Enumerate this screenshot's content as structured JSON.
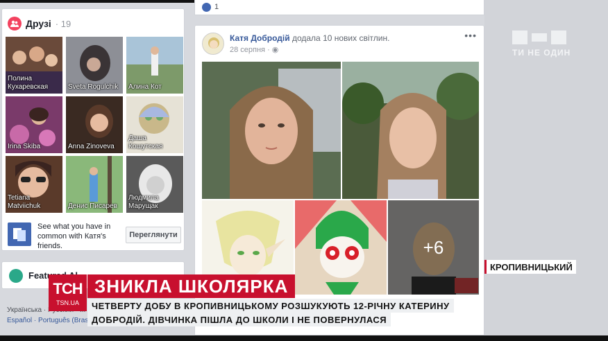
{
  "friends": {
    "title": "Друзі",
    "count": "· 19",
    "tiles": [
      {
        "name": "Полина Кухаревская",
        "color": "#6a4a3a"
      },
      {
        "name": "Sveta Rogulchik",
        "color": "#8d8f96"
      },
      {
        "name": "Алина Кот",
        "color": "#7d9a6a"
      },
      {
        "name": "Irina Skiba",
        "color": "#7a3a6a"
      },
      {
        "name": "Anna Zinoveva",
        "color": "#5a3a2a"
      },
      {
        "name": "Даша Кошутская",
        "color": "#c9b88a"
      },
      {
        "name": "Tetiana Matviichuk",
        "color": "#6a4a3a"
      },
      {
        "name": "Денис Писарев",
        "color": "#7aa06a"
      },
      {
        "name": "Людмила Марущак",
        "color": "#7b7b7b"
      }
    ],
    "common_text": "See what you have in common with Катя's friends.",
    "common_button": "Переглянути"
  },
  "featured": {
    "title": "Featured Al..."
  },
  "languages": {
    "line1": "Українська · Русский · ...",
    "line2": "Español · Português (Brasil)"
  },
  "top_post": {
    "like_count": "1"
  },
  "post": {
    "author": "Катя Добродій",
    "action": "додала 10 нових світлин.",
    "date": "28 серпня ·",
    "more": "•••",
    "more_photos": "+6"
  },
  "watermark": {
    "logo": "1+1",
    "slogan": "ТИ НЕ ОДИН"
  },
  "tsn": {
    "logo": "ТСН",
    "site": "TSN.UA",
    "city": "КРОПИВНИЦЬКИЙ",
    "headline": "ЗНИКЛА ШКОЛЯРКА",
    "subtitle_line1": "ЧЕТВЕРТУ ДОБУ В КРОПИВНИЦЬКОМУ РОЗШУКУЮТЬ 12-РІЧНУ КАТЕРИНУ",
    "subtitle_line2": "ДОБРОДІЙ. ДІВЧИНКА ПІШЛА ДО ШКОЛИ І НЕ ПОВЕРНУЛАСЯ",
    "accent": "#c8102e"
  }
}
